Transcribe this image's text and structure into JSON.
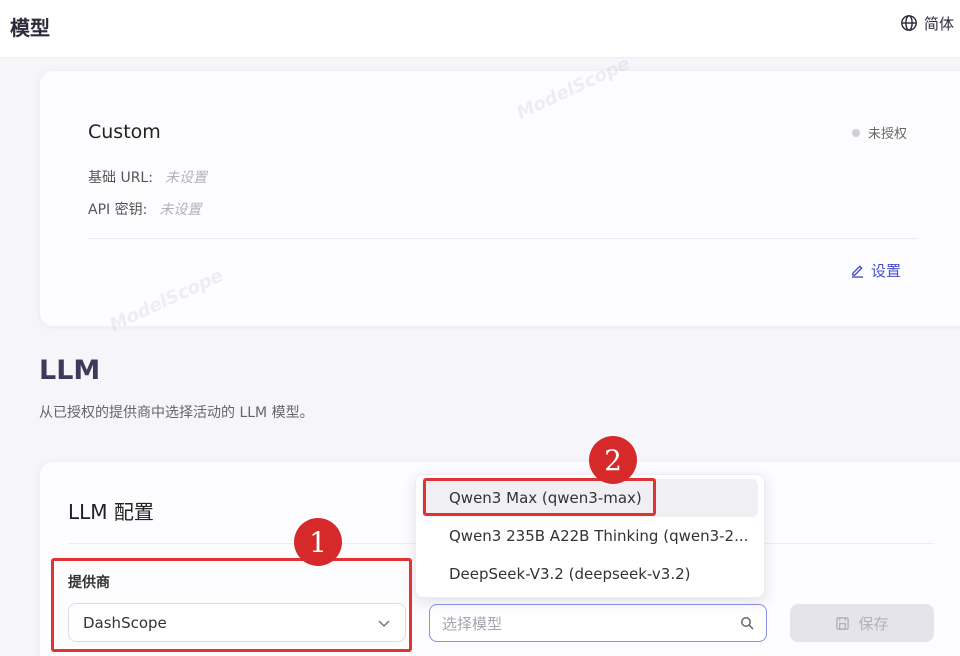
{
  "header": {
    "title": "模型",
    "language_label": "简体"
  },
  "custom_provider": {
    "name": "Custom",
    "status": "未授权",
    "fields": [
      {
        "label": "基础 URL:",
        "value": "未设置"
      },
      {
        "label": "API 密钥:",
        "value": "未设置"
      }
    ],
    "edit_label": "设置"
  },
  "watermark": "ModelScope",
  "llm_section": {
    "title": "LLM",
    "subtitle": "从已授权的提供商中选择活动的 LLM 模型。"
  },
  "llm_config": {
    "title": "LLM 配置",
    "provider_label": "提供商",
    "provider_value": "DashScope",
    "model_placeholder": "选择模型",
    "save_label": "保存",
    "model_options": [
      "Qwen3 Max (qwen3-max)",
      "Qwen3 235B A22B Thinking (qwen3-2...",
      "DeepSeek-V3.2 (deepseek-v3.2)"
    ]
  },
  "annotations": {
    "badge1": "1",
    "badge2": "2"
  },
  "colors": {
    "accent": "#4b4fc7",
    "highlight": "#e03333",
    "badge": "#d62a2a",
    "focus_border": "#8d8fe6"
  },
  "icons": {
    "language": "globe-icon",
    "edit": "pencil-icon",
    "select": "chevron-down-icon",
    "search": "search-icon",
    "save": "save-icon"
  }
}
